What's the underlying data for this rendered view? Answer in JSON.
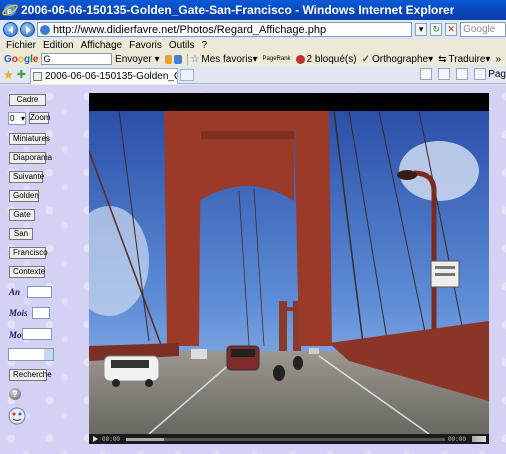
{
  "window": {
    "title": "2006-06-06-150135-Golden_Gate-San-Francisco - Windows Internet Explorer"
  },
  "address_bar": {
    "url": "http://www.didierfavre.net/Photos/Regard_Affichage.php",
    "search_placeholder": "Google"
  },
  "menu": {
    "items": [
      "Fichier",
      "Edition",
      "Affichage",
      "Favoris",
      "Outils",
      "?"
    ]
  },
  "google_toolbar": {
    "logo": "Google",
    "search_value": "G",
    "items": [
      "Envoyer",
      "Mes favoris",
      "PageRank",
      "2 bloqué(s)",
      "Orthographe",
      "Traduire",
      "»"
    ]
  },
  "tabs": [
    {
      "label": "2006-06-06-150135-Golden_Gate-..."
    }
  ],
  "tab_tools": {
    "page_label": "Pag"
  },
  "sidebar": {
    "cadre_label": "Cadre",
    "zoom_value": "0",
    "zoom_label": "Zoom",
    "buttons": [
      "Miniatures",
      "Diaporama",
      "Suivante",
      "Golden",
      "Gate",
      "San",
      "Francisco",
      "Contexte"
    ],
    "date_labels": [
      "An",
      "Mois",
      "Mot"
    ],
    "search_label": "Recherche",
    "help_icon": "?"
  },
  "video": {
    "elapsed": "00:00",
    "duration": "00:00",
    "progress": 0.12
  },
  "colors": {
    "titlebar": "#0846b8",
    "page_background": "#d4d2f4",
    "bridge_tower": "#9a3b2a"
  }
}
